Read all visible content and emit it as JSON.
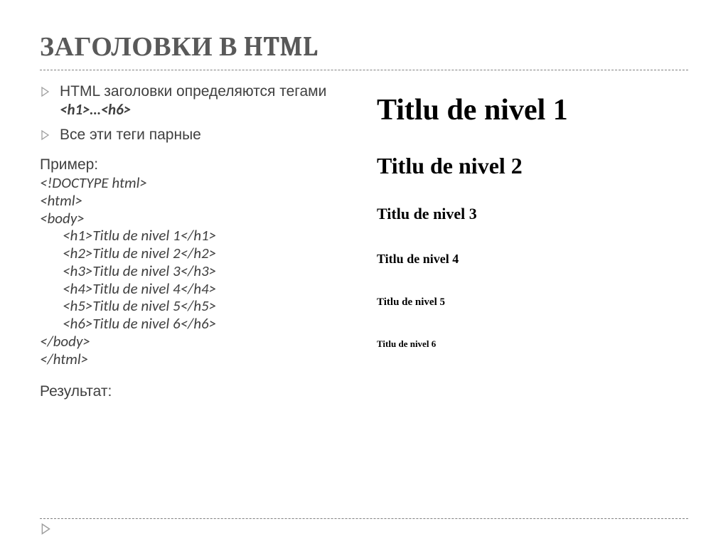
{
  "slide": {
    "title": "ЗАГОЛОВКИ В HTML",
    "bullets": [
      {
        "pre": "HTML заголовки определяются тегами ",
        "code": "<h1>…<h6>"
      },
      {
        "pre": "Все эти теги парные",
        "code": ""
      }
    ],
    "example_label": "Пример:",
    "code_lines": {
      "l1": "<!DOCTYPE html>",
      "l2": "<html>",
      "l3": "<body>",
      "l4": "<h1>Titlu de nivel 1</h1>",
      "l5": "<h2>Titlu de nivel 2</h2>",
      "l6": "<h3>Titlu de nivel 3</h3>",
      "l7": "<h4>Titlu de nivel 4</h4>",
      "l8": "<h5>Titlu de nivel 5</h5>",
      "l9": "<h6>Titlu de nivel 6</h6>",
      "l10": "</body>",
      "l11": "</html>"
    },
    "result_label": "Результат:",
    "render": {
      "h1": "Titlu de nivel 1",
      "h2": "Titlu de nivel 2",
      "h3": "Titlu de nivel 3",
      "h4": "Titlu de nivel 4",
      "h5": "Titlu de nivel 5",
      "h6": "Titlu de nivel 6"
    }
  }
}
